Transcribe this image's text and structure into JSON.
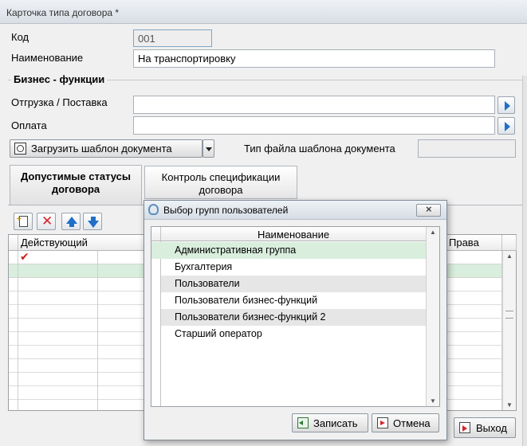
{
  "window": {
    "title": "Карточка типа договора *"
  },
  "form": {
    "code_label": "Код",
    "code_value": "001",
    "name_label": "Наименование",
    "name_value": "На транспортировку"
  },
  "business_functions": {
    "title": "Бизнес - функции",
    "shipment_label": "Отгрузка / Поставка",
    "shipment_value": "",
    "payment_label": "Оплата",
    "payment_value": ""
  },
  "template": {
    "load_button_label": "Загрузить шаблон документа",
    "file_type_label": "Тип файла шаблона документа",
    "file_type_value": ""
  },
  "tabs": [
    {
      "line1": "Допустимые статусы",
      "line2": "договора",
      "active": true
    },
    {
      "line1": "Контроль спецификации",
      "line2": "договора",
      "active": false
    }
  ],
  "status_grid": {
    "col_active": "Действующий",
    "col_rights": "Права",
    "rows": [
      {
        "active": true
      },
      {
        "active": false
      }
    ]
  },
  "footer": {
    "exit_label": "Выход"
  },
  "dialog": {
    "title": "Выбор групп пользователей",
    "column_name": "Наименование",
    "rows": [
      "Административная группа",
      "Бухгалтерия",
      "Пользователи",
      "Пользователи бизнес-функций",
      "Пользователи бизнес-функций 2",
      "Старший оператор"
    ],
    "selected_index": 0,
    "save_label": "Записать",
    "cancel_label": "Отмена"
  },
  "colors": {
    "selection_row": "#d9eedd",
    "accent_blue": "#1f6fc9",
    "delete_red": "#d8232a",
    "check_red": "#cc1f1f"
  },
  "icons": {
    "template_load": "template-load-icon",
    "add": "add-record-icon",
    "delete": "delete-icon",
    "up": "arrow-up-icon",
    "down": "arrow-down-icon",
    "save": "save-icon",
    "cancel": "cancel-icon",
    "exit": "exit-icon"
  }
}
